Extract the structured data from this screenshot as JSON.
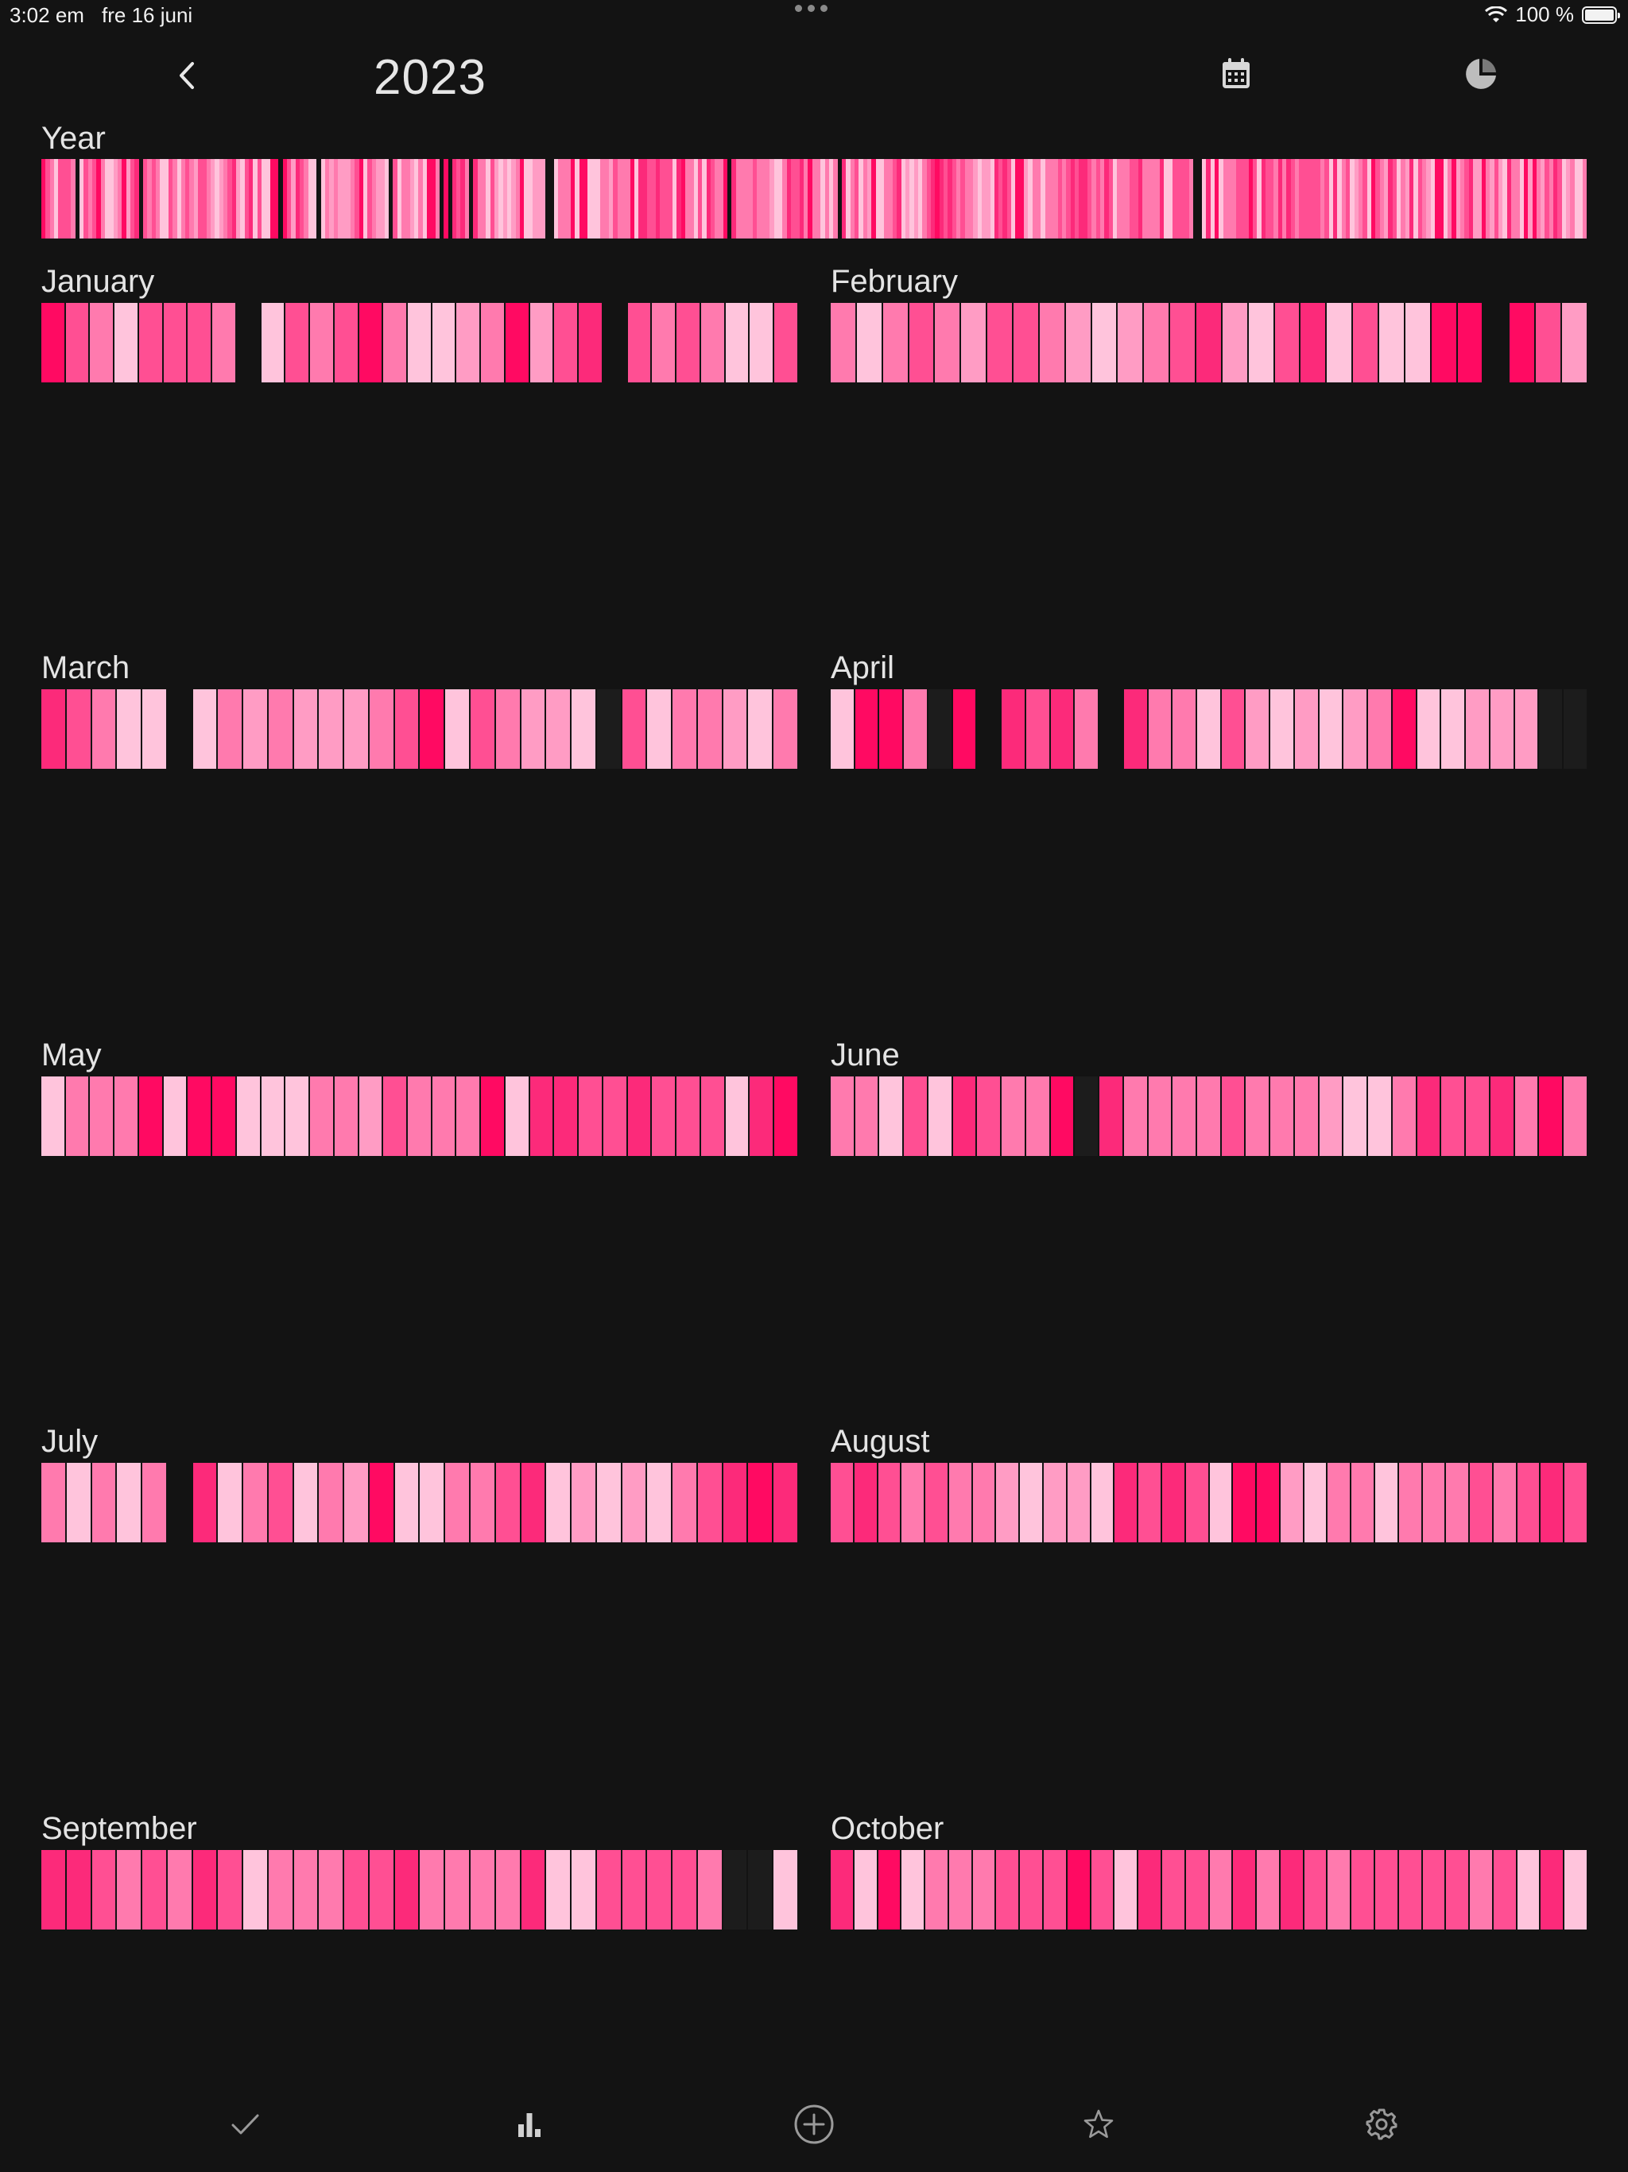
{
  "status_bar": {
    "time": "3:02 em",
    "date": "fre 16 juni",
    "battery": "100 %"
  },
  "header": {
    "year": "2023"
  },
  "labels": {
    "year": "Year",
    "january": "January",
    "february": "February",
    "march": "March",
    "april": "April",
    "may": "May",
    "june": "June",
    "july": "July",
    "august": "August",
    "september": "September",
    "october": "October"
  },
  "colors": {
    "background": "#131313",
    "empty": "#1c1c1c",
    "levels": [
      "#ffc4dc",
      "#ff9cc4",
      "#ff7aae",
      "#ff4f93",
      "#fc2a7a",
      "#ff0a62"
    ]
  },
  "months": [
    {
      "key": "january",
      "days": [
        5,
        3,
        2,
        0,
        3,
        3,
        3,
        2,
        -1,
        0,
        3,
        2,
        3,
        5,
        2,
        0,
        0,
        1,
        2,
        5,
        1,
        3,
        4,
        -1,
        3,
        2,
        3,
        2,
        0,
        0,
        3
      ]
    },
    {
      "key": "february",
      "days": [
        2,
        0,
        2,
        3,
        2,
        1,
        3,
        3,
        2,
        1,
        0,
        1,
        2,
        3,
        4,
        1,
        0,
        3,
        4,
        0,
        3,
        0,
        0,
        5,
        5,
        -1,
        5,
        3,
        1
      ]
    },
    {
      "key": "march",
      "days": [
        4,
        3,
        2,
        0,
        0,
        -1,
        0,
        2,
        1,
        2,
        1,
        1,
        1,
        2,
        3,
        5,
        0,
        3,
        2,
        1,
        1,
        0,
        -2,
        3,
        0,
        2,
        2,
        1,
        0,
        2
      ]
    },
    {
      "key": "april",
      "days": [
        0,
        5,
        5,
        2,
        -2,
        5,
        -1,
        4,
        3,
        4,
        2,
        -1,
        4,
        2,
        2,
        0,
        3,
        1,
        0,
        1,
        0,
        1,
        2,
        5,
        0,
        0,
        1,
        1,
        1,
        -2,
        -2
      ]
    },
    {
      "key": "may",
      "days": [
        0,
        2,
        2,
        2,
        5,
        0,
        5,
        5,
        0,
        0,
        0,
        2,
        2,
        1,
        3,
        2,
        2,
        2,
        5,
        0,
        4,
        4,
        3,
        3,
        4,
        3,
        3,
        3,
        0,
        4,
        5
      ]
    },
    {
      "key": "june",
      "days": [
        2,
        2,
        0,
        3,
        0,
        4,
        3,
        2,
        2,
        5,
        -2,
        4,
        2,
        2,
        2,
        2,
        3,
        2,
        2,
        2,
        1,
        0,
        0,
        2,
        4,
        3,
        3,
        4,
        2,
        5,
        2
      ]
    },
    {
      "key": "july",
      "days": [
        2,
        0,
        2,
        0,
        2,
        -1,
        4,
        0,
        2,
        3,
        0,
        2,
        1,
        5,
        0,
        0,
        2,
        2,
        3,
        4,
        0,
        1,
        0,
        1,
        0,
        2,
        3,
        4,
        5,
        4
      ]
    },
    {
      "key": "august",
      "days": [
        3,
        4,
        3,
        2,
        3,
        2,
        2,
        1,
        0,
        1,
        1,
        0,
        4,
        3,
        4,
        3,
        0,
        5,
        5,
        1,
        0,
        2,
        2,
        0,
        2,
        2,
        2,
        3,
        2,
        3,
        4,
        3
      ]
    },
    {
      "key": "september",
      "days": [
        4,
        4,
        3,
        2,
        3,
        2,
        4,
        3,
        0,
        2,
        2,
        2,
        3,
        3,
        4,
        2,
        2,
        2,
        2,
        4,
        0,
        0,
        3,
        3,
        3,
        3,
        2,
        -2,
        -2,
        0
      ]
    },
    {
      "key": "october",
      "days": [
        4,
        0,
        5,
        0,
        2,
        2,
        2,
        3,
        3,
        3,
        5,
        3,
        0,
        4,
        3,
        3,
        2,
        4,
        2,
        4,
        3,
        2,
        3,
        3,
        3,
        3,
        3,
        2,
        3,
        0,
        4,
        0
      ]
    }
  ],
  "icons": {
    "back": "chevron-left-icon",
    "calendar": "calendar-icon",
    "pie": "pie-chart-icon",
    "tabs": [
      "checkmark-icon",
      "bar-chart-icon",
      "add-circle-icon",
      "star-icon",
      "gear-icon"
    ]
  }
}
